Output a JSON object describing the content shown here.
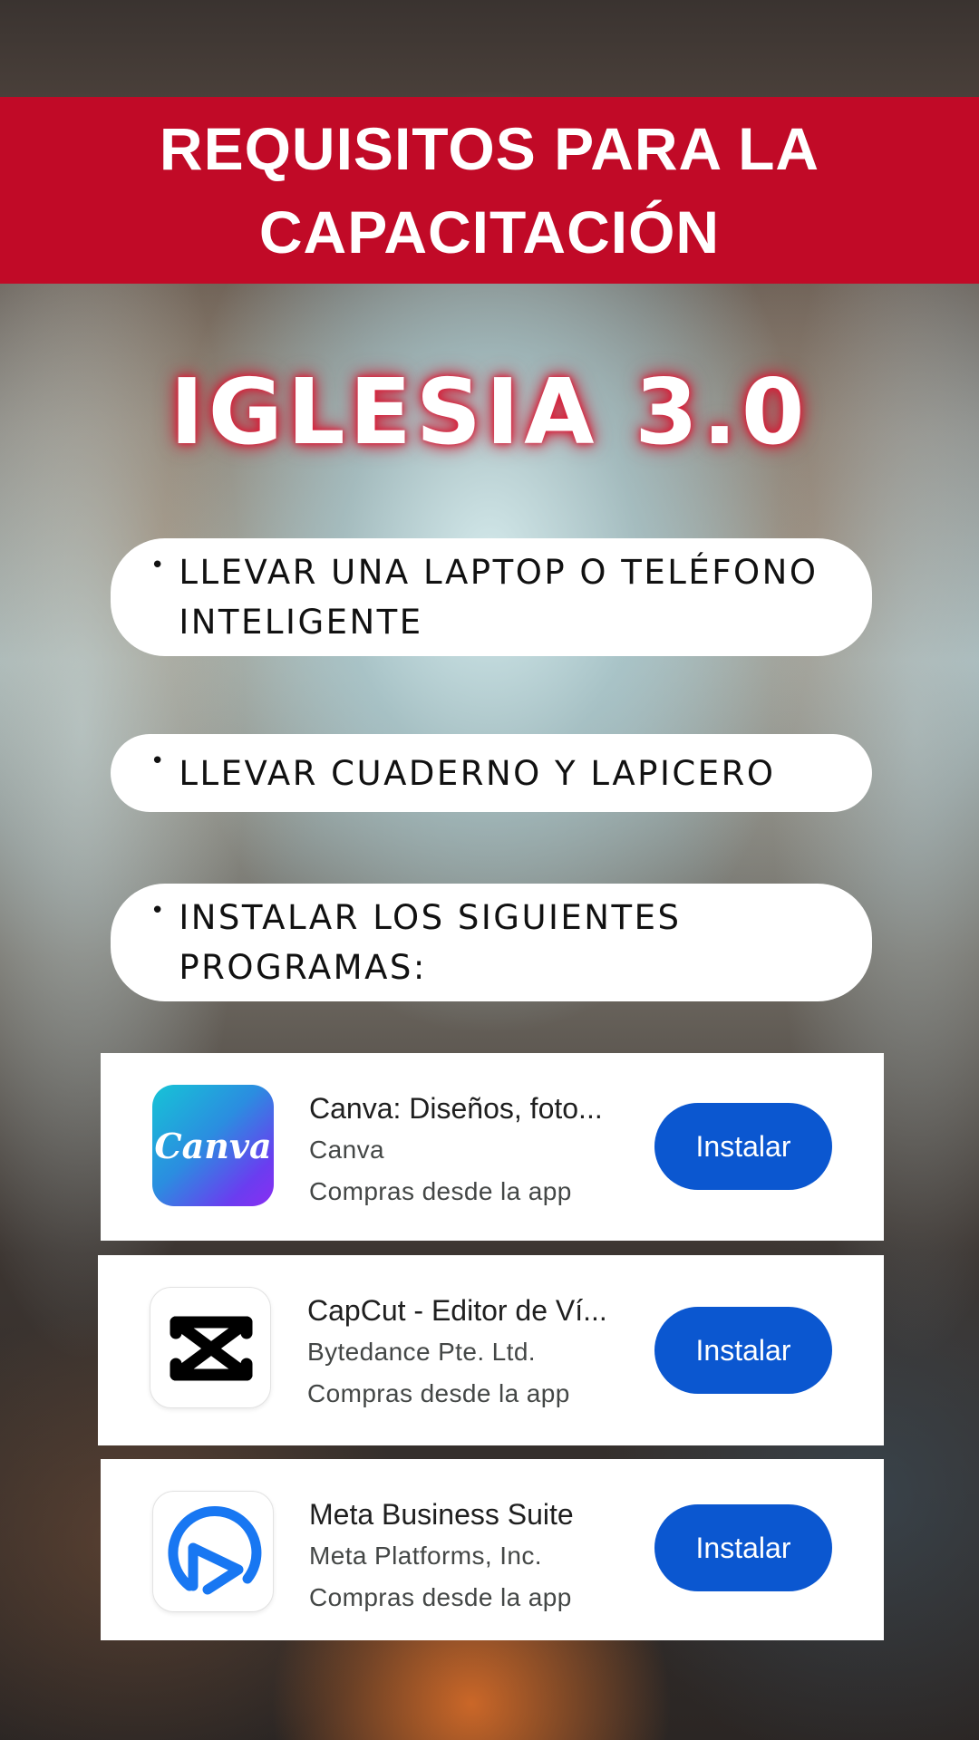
{
  "header": {
    "line1": "REQUISITOS PARA LA",
    "line2": "CAPACITACIÓN",
    "color": "#c10a27"
  },
  "event_title": "IGLESIA 3.0",
  "requirements": [
    {
      "line1": "LLEVAR UNA LAPTOP O TELÉFONO",
      "line2": "INTELIGENTE"
    },
    {
      "line1": "LLEVAR CUADERNO Y LAPICERO"
    },
    {
      "line1": "INSTALAR LOS SIGUIENTES",
      "line2": "PROGRAMAS:"
    }
  ],
  "bullet": "•",
  "apps": [
    {
      "icon": "canva-logo-icon",
      "icon_text": "Canva",
      "name": "Canva: Diseños, foto...",
      "developer": "Canva",
      "iap": "Compras desde la app",
      "button": "Instalar"
    },
    {
      "icon": "capcut-logo-icon",
      "name": "CapCut - Editor de Ví...",
      "developer": "Bytedance Pte. Ltd.",
      "iap": "Compras desde la app",
      "button": "Instalar"
    },
    {
      "icon": "meta-business-suite-logo-icon",
      "name": "Meta Business Suite",
      "developer": "Meta Platforms, Inc.",
      "iap": "Compras desde la app",
      "button": "Instalar"
    }
  ],
  "colors": {
    "install_button": "#0b57d0",
    "meta_icon": "#1877f2"
  }
}
